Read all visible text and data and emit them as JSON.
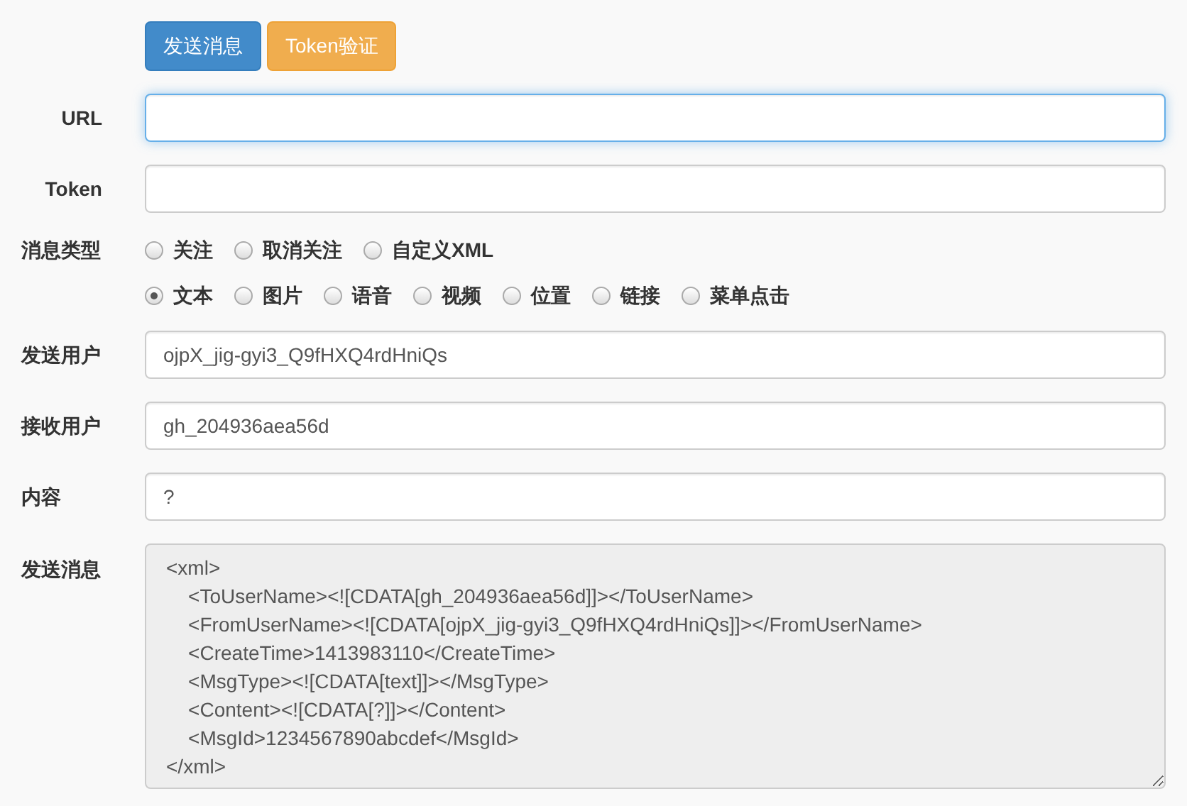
{
  "buttons": [
    {
      "label": "发送消息",
      "kind": "primary"
    },
    {
      "label": "Token验证",
      "kind": "warning"
    }
  ],
  "url": {
    "label": "URL",
    "focused": true
  },
  "token": {
    "label": "Token",
    "focused": false
  },
  "message_type": {
    "label": "消息类型",
    "event_options": [
      {
        "label": "关注",
        "selected": false
      },
      {
        "label": "取消关注",
        "selected": false
      },
      {
        "label": "自定义XML",
        "selected": false
      }
    ],
    "message_options": [
      {
        "label": "文本",
        "selected": true
      },
      {
        "label": "图片",
        "selected": false
      },
      {
        "label": "语音",
        "selected": false
      },
      {
        "label": "视频",
        "selected": false
      },
      {
        "label": "位置",
        "selected": false
      },
      {
        "label": "链接",
        "selected": false
      },
      {
        "label": "菜单点击",
        "selected": false
      }
    ]
  },
  "fields": [
    {
      "label": "发送用户",
      "value": "ojpX_jig-gyi3_Q9fHXQ4rdHniQs",
      "focused": false
    },
    {
      "label": "接收用户",
      "value": "gh_204936aea56d",
      "focused": false
    },
    {
      "label": "内容",
      "value": "?",
      "focused": false
    }
  ],
  "send_message": {
    "label": "发送消息",
    "lines": [
      "<xml>",
      "    <ToUserName><![CDATA[gh_204936aea56d]]></ToUserName>",
      "    <FromUserName><![CDATA[ojpX_jig-gyi3_Q9fHXQ4rdHniQs]]></FromUserName>",
      "    <CreateTime>1413983110</CreateTime>",
      "    <MsgType><![CDATA[text]]></MsgType>",
      "    <Content><![CDATA[?]]></Content>",
      "    <MsgId>1234567890abcdef</MsgId>",
      "</xml>"
    ]
  }
}
